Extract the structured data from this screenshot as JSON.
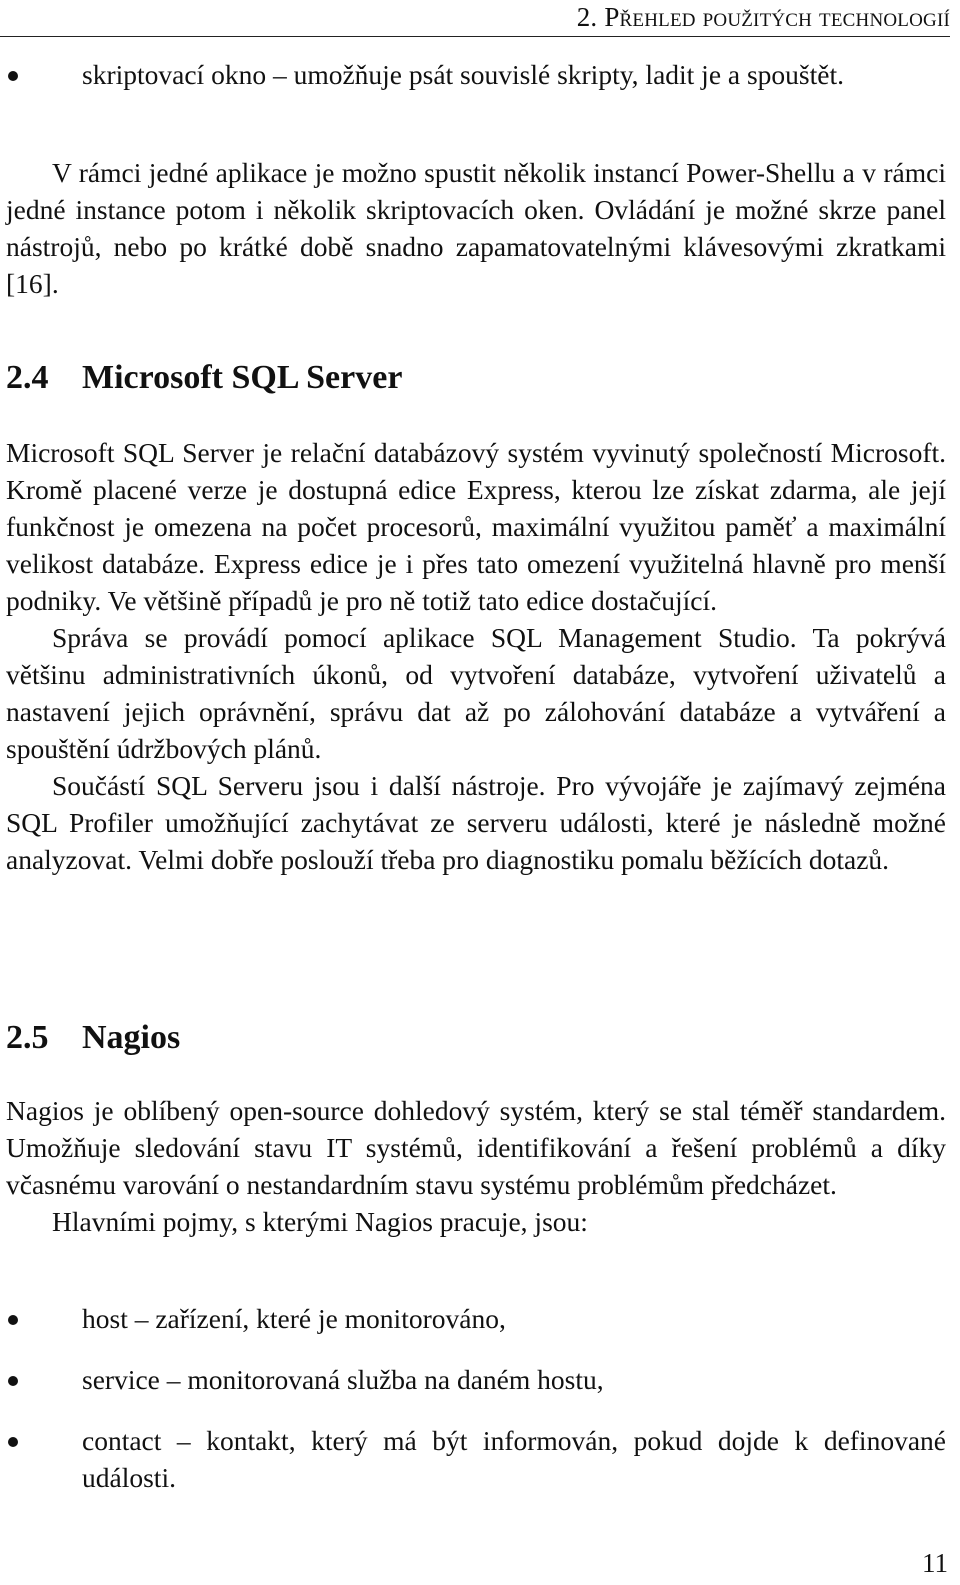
{
  "running_head": "2. Přehled použitých technologií",
  "top_list": [
    {
      "text": "skriptovací okno – umožňuje psát souvislé skripty, ladit je a spouštět."
    }
  ],
  "intro_paragraph": "V rámci jedné aplikace je možno spustit několik instancí Power-Shellu a v rámci jedné instance potom i několik skriptovacích oken. Ovládání je možné skrze panel nástrojů, nebo po krátké době snadno zapamatovatelnými klávesovými zkratkami [16].",
  "sections": [
    {
      "number": "2.4",
      "title": "Microsoft SQL Server",
      "paragraphs": [
        "Microsoft SQL Server je relační databázový systém vyvinutý společností Microsoft. Kromě placené verze je dostupná edice Express, kterou lze získat zdarma, ale její funkčnost je omezena na počet procesorů, maximální využitou paměť a maximální velikost databáze. Express edice je i přes tato omezení využitelná hlavně pro menší podniky. Ve většině případů je pro ně totiž tato edice dostačující.",
        "Správa se provádí pomocí aplikace SQL Management Studio. Ta pokrývá většinu administrativních úkonů, od vytvoření databáze, vytvoření uživatelů a nastavení jejich oprávnění, správu dat až po zálohování databáze a vytváření a spouštění údržbových plánů.",
        "Součástí SQL Serveru jsou i další nástroje. Pro vývojáře je zajímavý zejména SQL Profiler umožňující zachytávat ze serveru události, které je následně možné analyzovat. Velmi dobře poslouží třeba pro diagnostiku pomalu běžících dotazů."
      ]
    },
    {
      "number": "2.5",
      "title": "Nagios",
      "paragraphs": [
        "Nagios je oblíbený open-source dohledový systém, který se stal téměř standardem. Umožňuje sledování stavu IT systémů, identifikování a řešení problémů a díky včasnému varování o nestandardním stavu systému problémům předcházet.",
        "Hlavními pojmy, s kterými Nagios pracuje, jsou:"
      ],
      "list": [
        {
          "text": "host – zařízení, které je monitorováno,"
        },
        {
          "text": "service – monitorovaná služba na daném hostu,"
        },
        {
          "text": "contact – kontakt, který má být informován, pokud dojde k definované události."
        }
      ]
    }
  ],
  "page_number": "11"
}
